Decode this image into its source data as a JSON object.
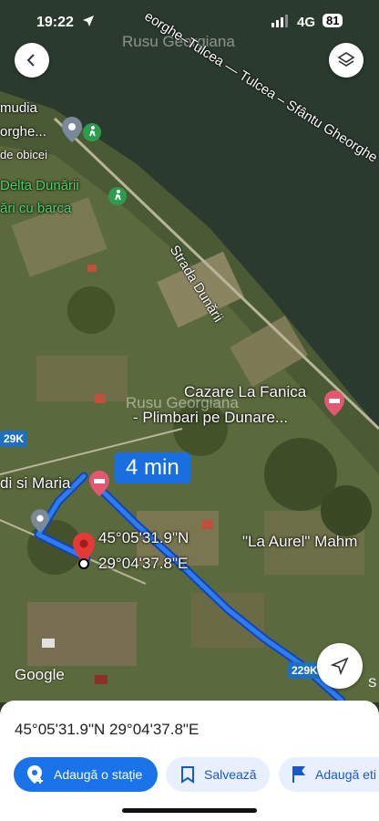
{
  "status_bar": {
    "time": "19:22",
    "network": "4G",
    "battery": "81"
  },
  "watermark": "Rusu Georgiana",
  "map": {
    "place_labels": [
      "mudia",
      "orghe...",
      "de obicei",
      "Delta Dunării",
      "ări cu barca",
      "Cazare La Fanica",
      "- Plimbari pe Dunare...",
      "di si Maria",
      "\"La Aurel\" Mahm"
    ],
    "road_labels": [
      "Strada Dunării",
      "eorghe–Tulcea — Tulcea – Sfântu Gheorghe"
    ],
    "route_time": "4 min",
    "route_shields": [
      "29K",
      "229K"
    ],
    "coord_line1": "45°05'31.9\"N",
    "coord_line2": "29°04'37.8\"E",
    "google_logo": "Google",
    "corner_letter": "S"
  },
  "sheet": {
    "coordinates": "45°05'31.9\"N 29°04'37.8\"E",
    "chips": [
      {
        "label": "Adaugă o stație",
        "icon": "add-location-icon"
      },
      {
        "label": "Salvează",
        "icon": "bookmark-icon"
      },
      {
        "label": "Adaugă eti",
        "icon": "flag-icon"
      }
    ]
  },
  "colors": {
    "route": "#1a6fe0",
    "water": "#2c3c30",
    "land": "#5a6a3a",
    "primary_chip": "#1a73e8"
  }
}
